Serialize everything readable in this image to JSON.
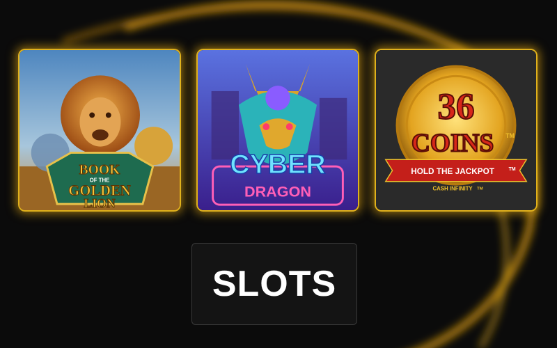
{
  "games": [
    {
      "logo_lines": [
        "BOOK",
        "OF THE",
        "GOLDEN",
        "LION"
      ],
      "logo_colors": {
        "text": "#f4c53a",
        "plate": "#1e6b4f",
        "sky": "#5f95c8",
        "ground": "#b9742a"
      }
    },
    {
      "logo_lines": [
        "CYBER",
        "DRAGON"
      ],
      "logo_colors": {
        "top": "#5a72e0",
        "bottom": "#3a1f8c",
        "cyber": "#6fe3ff",
        "dragon": "#ff5fb7"
      }
    },
    {
      "logo_lines": [
        "36",
        "COINS",
        "TM",
        "HOLD THE JACKPOT",
        "TM",
        "CASH INFINITY",
        "TM"
      ],
      "logo_colors": {
        "bg": "#2a2a2a",
        "coin": "#f0c12c",
        "red": "#d7271a",
        "ribbon": "#c41f1a"
      }
    }
  ],
  "slots_label": "SLOTS",
  "accent": "#f2b51b"
}
